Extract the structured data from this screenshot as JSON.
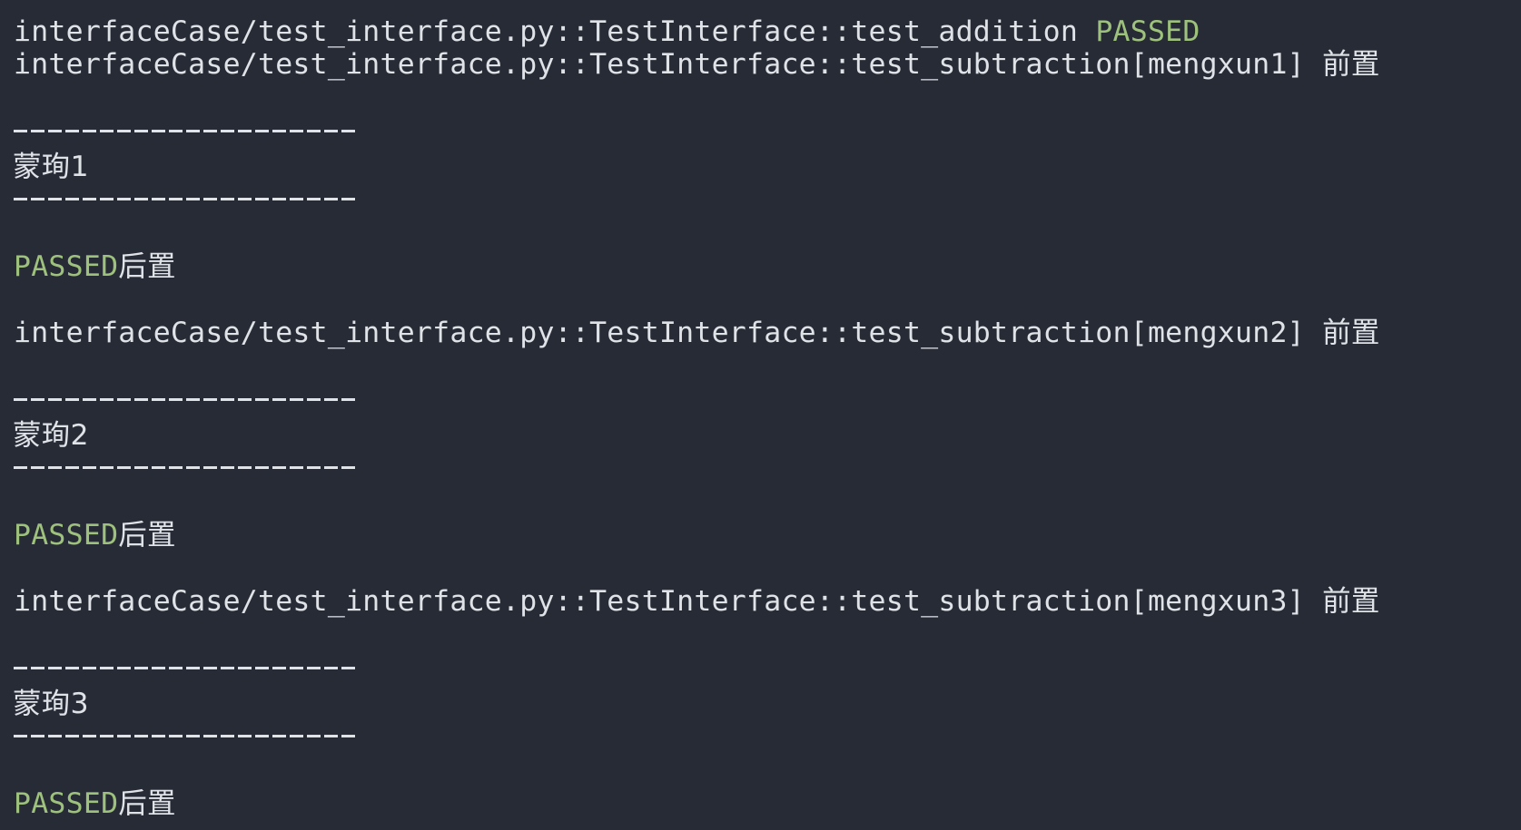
{
  "terminal": {
    "lines": [
      {
        "prefix": "interfaceCase/test_interface.py::TestInterface::test_addition ",
        "status": "PASSED"
      },
      {
        "prefix": "interfaceCase/test_interface.py::TestInterface::test_subtraction[mengxun1] ",
        "suffix": "前置"
      }
    ],
    "blocks": [
      {
        "divider_top": "--------------------",
        "value": "蒙珣1",
        "divider_bottom": "--------------------",
        "status": "PASSED",
        "suffix": "后置"
      },
      {
        "test_line_prefix": "interfaceCase/test_interface.py::TestInterface::test_subtraction[mengxun2] ",
        "test_line_suffix": "前置",
        "divider_top": "--------------------",
        "value": "蒙珣2",
        "divider_bottom": "--------------------",
        "status": "PASSED",
        "suffix": "后置"
      },
      {
        "test_line_prefix": "interfaceCase/test_interface.py::TestInterface::test_subtraction[mengxun3] ",
        "test_line_suffix": "前置",
        "divider_top": "--------------------",
        "value": "蒙珣3",
        "divider_bottom": "--------------------",
        "status": "PASSED",
        "suffix": "后置"
      }
    ],
    "colors": {
      "background": "#272b35",
      "text": "#dfe2e7",
      "passed": "#9ec27d"
    }
  }
}
